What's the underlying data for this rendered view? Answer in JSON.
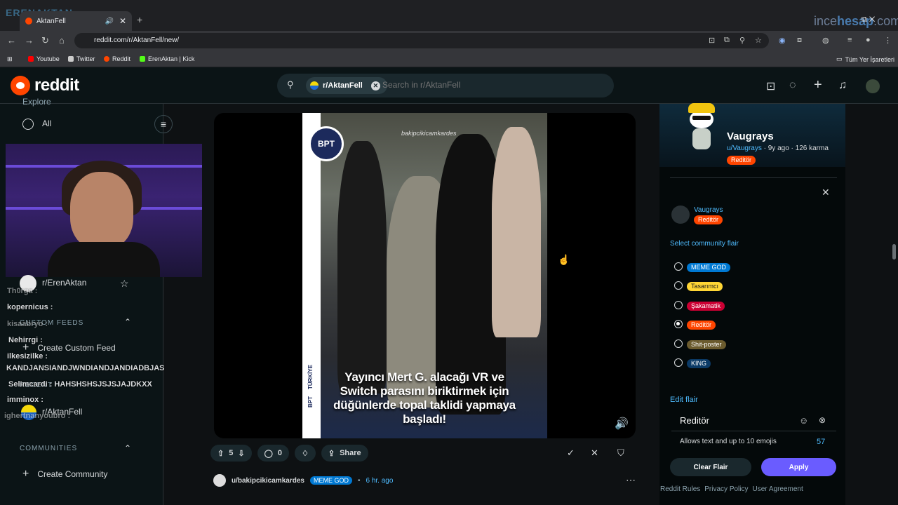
{
  "browser": {
    "tab_title": "AktanFell",
    "new_tab_icon": "+",
    "url": "reddit.com/r/AktanFell/new/",
    "bookmarks": [
      {
        "label": "Youtube",
        "color": "#ff0000"
      },
      {
        "label": "Twitter",
        "color": "#cccccc"
      },
      {
        "label": "Reddit",
        "color": "#ff4500"
      },
      {
        "label": "ErenAktan | Kick",
        "color": "#53fc18"
      }
    ],
    "all_bookmarks": "Tüm Yer İşaretleri",
    "overlay_left": "ERENAKTAN",
    "overlay_right_a": "ince",
    "overlay_right_b": "hesap",
    "overlay_right_c": ".com"
  },
  "header": {
    "logo_text": "reddit",
    "search_chip": "r/AktanFell",
    "search_placeholder": "Search in r/AktanFell"
  },
  "sidebar": {
    "explore": "Explore",
    "all": "All",
    "community_1": "r/ErenAktan",
    "custom_feeds": "CUSTOM FEEDS",
    "create_custom_feed": "Create Custom Feed",
    "recent": "RECENT",
    "community_2": "r/AktanFell",
    "communities": "COMMUNITIES",
    "create_community": "Create Community"
  },
  "chat_overlay": [
    "Th0rga :",
    "kopernicus :",
    "kisaabryo :",
    "Nehirrgi :",
    "ilkesizilke :",
    "KANDJANSIANDJWNDIANDJANDIADBJAS",
    "Selimcardi : HAHSHSHSJSJSJAJDKXX",
    "imminox :",
    "ighertnanyoubro :"
  ],
  "post": {
    "video_logo": "BPT",
    "video_watermark": "bakipcikicamkardes",
    "video_side_a": "TÜRKİYE",
    "video_side_b": "BPT",
    "video_caption": "Yayıncı Mert G. alacağı VR ve Switch parasını biriktirmek için düğünlerde topal taklidi yapmaya başladı!",
    "votes": "5",
    "comments": "0",
    "share": "Share"
  },
  "next_post": {
    "user": "u/bakipcikicamkardes",
    "flair": "MEME GOD",
    "time": "6 hr. ago"
  },
  "user_card": {
    "name": "Vaugrays",
    "handle": "u/Vaugrays",
    "age": "9y ago",
    "karma": "126 karma",
    "flair": "Reditör"
  },
  "flair_picker": {
    "user": "Vaugrays",
    "current_flair": "Reditör",
    "heading": "Select community flair",
    "options": [
      {
        "label": "MEME GOD",
        "bg": "#0079d3",
        "fg": "#ffffff",
        "selected": false
      },
      {
        "label": "Tasarımcı",
        "bg": "#ffd635",
        "fg": "#1a1a1b",
        "selected": false
      },
      {
        "label": "Şakamatik",
        "bg": "#cc0033",
        "fg": "#ffffff",
        "selected": false
      },
      {
        "label": "Reditör",
        "bg": "#ff4500",
        "fg": "#ffffff",
        "selected": true
      },
      {
        "label": "Shit-poster",
        "bg": "#6b5b2e",
        "fg": "#ffffff",
        "selected": false
      },
      {
        "label": "KING",
        "bg": "#0b3a66",
        "fg": "#ffffff",
        "selected": false
      }
    ],
    "edit_heading": "Edit flair",
    "edit_value": "Reditör",
    "hint": "Allows text and up to 10 emojis",
    "remaining": "57",
    "clear_label": "Clear Flair",
    "apply_label": "Apply"
  },
  "footer_links": [
    "Reddit Rules",
    "Privacy Policy",
    "User Agreement"
  ],
  "colors": {
    "accent": "#ff4500",
    "link": "#4fbcff",
    "apply": "#6a5cff"
  }
}
